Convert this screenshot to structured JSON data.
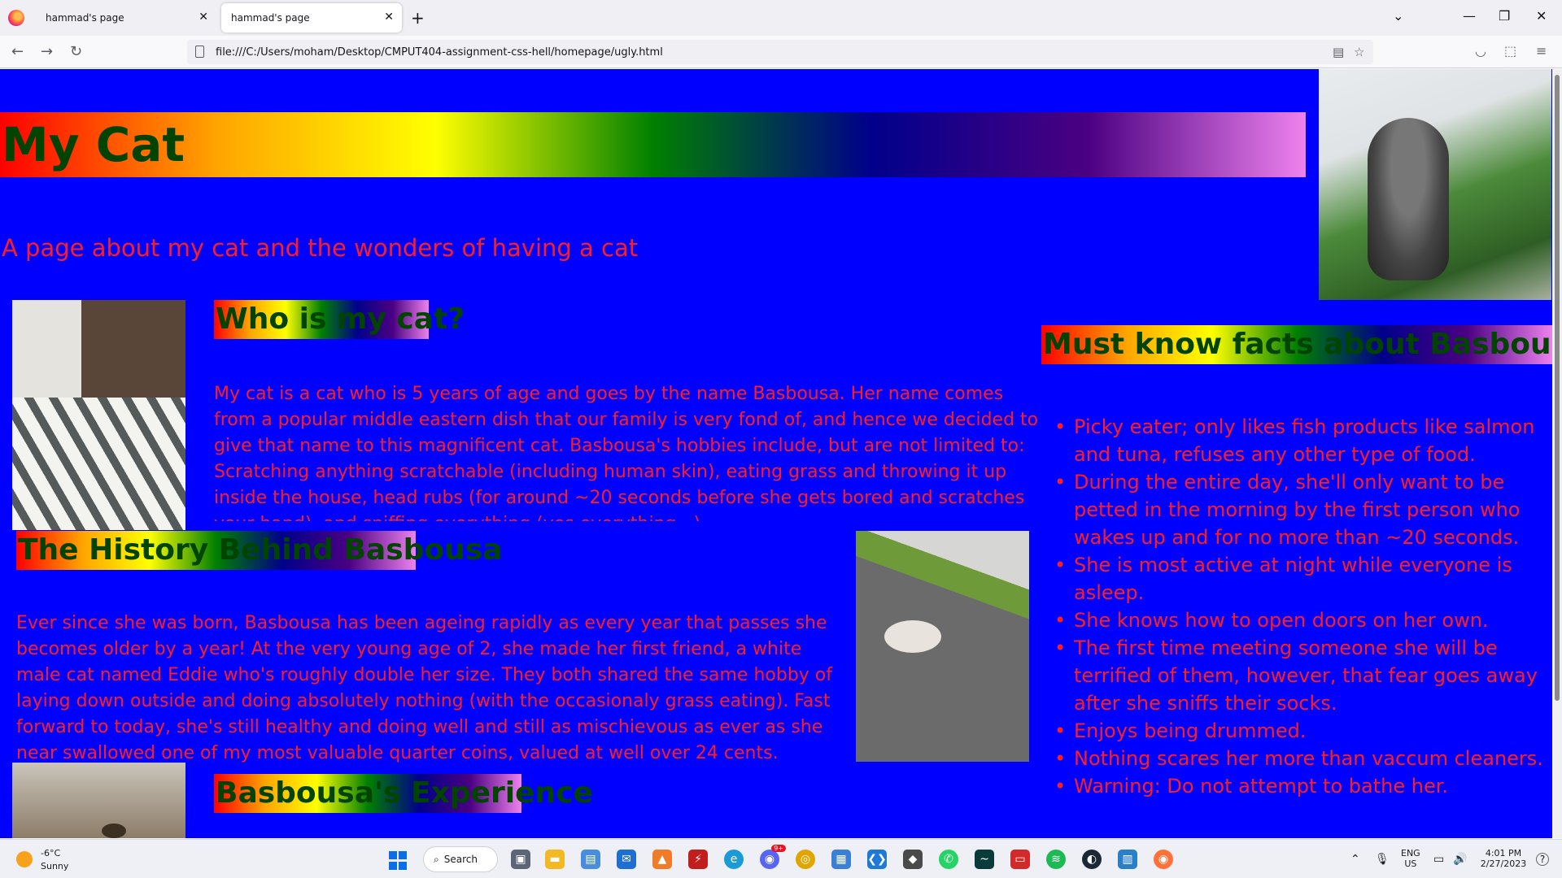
{
  "browser": {
    "tabs": [
      {
        "title": "hammad's page"
      },
      {
        "title": "hammad's page"
      }
    ],
    "url": "file:///C:/Users/moham/Desktop/CMPUT404-assignment-css-hell/homepage/ugly.html"
  },
  "page": {
    "title": "My Cat",
    "subtitle": "A page about my cat and the wonders of having a cat",
    "who": {
      "heading": "Who is my cat?",
      "text": "My cat is a cat who is 5 years of age and goes by the name Basbousa. Her name comes from a popular middle eastern dish that our family is very fond of, and hence we decided to give that name to this magnificent cat. Basbousa's hobbies include, but are not limited to: Scratching anything scratchable (including human skin), eating grass and throwing it up inside the house, head rubs (for around ~20 seconds before she gets bored and scratches your hand), and sniffing everything (yes everything...)."
    },
    "history": {
      "heading": "The History Behind Basbousa",
      "text": "Ever since she was born, Basbousa has been ageing rapidly as every year that passes she becomes older by a year! At the very young age of 2, she made her first friend, a white male cat named Eddie who's roughly double her size. They both shared the same hobby of laying down outside and doing absolutely nothing (with the occasionaly grass eating). Fast forward to today, she's still healthy and doing well and still as mischievous as ever as she near swallowed one of my most valuable quarter coins, valued at well over 24 cents."
    },
    "experience": {
      "heading": "Basbousa's Experience"
    },
    "facts": {
      "heading": "Must know facts about Basbousa",
      "items": [
        "Picky eater; only likes fish products like salmon and tuna, refuses any other type of food.",
        "During the entire day, she'll only want to be petted in the morning by the first person who wakes up and for no more than ~20 seconds.",
        "She is most active at night while everyone is asleep.",
        "She knows how to open doors on her own.",
        "The first time meeting someone she will be terrified of them, however, that fear goes away after she sniffs their socks.",
        "Enjoys being drummed.",
        "Nothing scares her more than vaccum cleaners.",
        "Warning: Do not attempt to bathe her."
      ]
    },
    "colors": {
      "background": "#0000ff",
      "text": "#ff1e1e",
      "heading_text": "#004400"
    }
  },
  "taskbar": {
    "weather": {
      "temp": "-6°C",
      "condition": "Sunny"
    },
    "search_label": "Search",
    "language": "ENG",
    "region": "US",
    "time": "4:01 PM",
    "date": "2/27/2023",
    "discord_badge": "9+"
  }
}
